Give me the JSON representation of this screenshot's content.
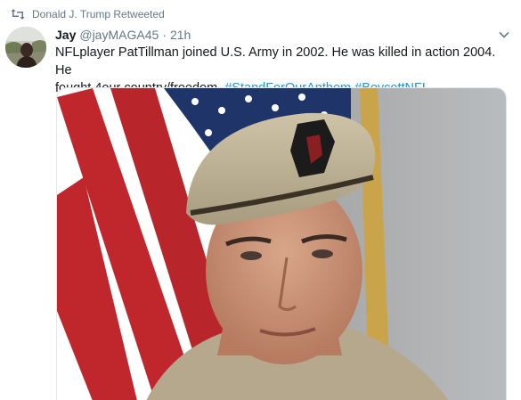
{
  "retweet": {
    "label": "Donald J. Trump Retweeted",
    "icon": "retweet-icon"
  },
  "tweet": {
    "display_name": "Jay",
    "handle": "@jayMAGA45",
    "separator": "·",
    "time": "21h",
    "text_line1": "NFLplayer PatTillman joined U.S. Army in 2002. He was killed in action 2004. He",
    "text_line2_prefix": "fought 4our country/freedom. ",
    "hashtag1": "#StandForOurAnthem",
    "hashtag2": "#BoycottNFL",
    "caret_icon": "chevron-down-icon"
  },
  "colors": {
    "link": "#1b95e0",
    "muted": "#657786",
    "text": "#14171a"
  },
  "media": {
    "description_icon": "photo"
  }
}
